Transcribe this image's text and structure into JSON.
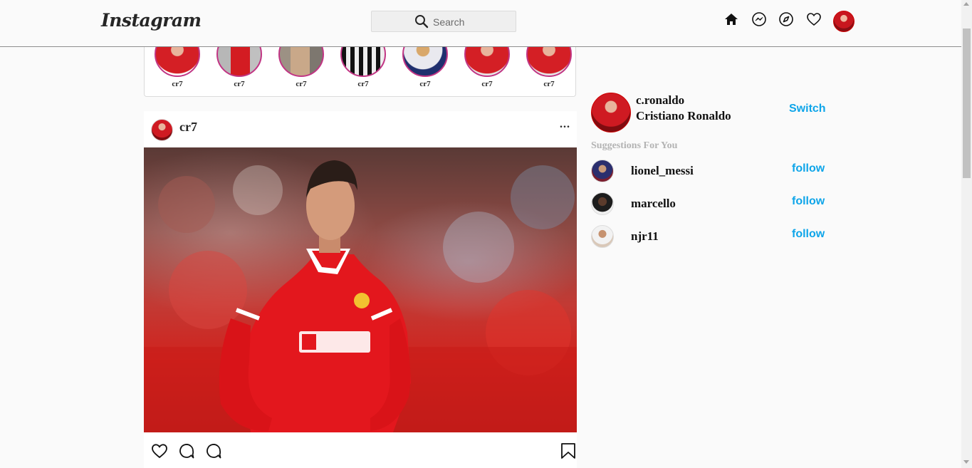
{
  "header": {
    "logo": "Instagram",
    "search_placeholder": "Search",
    "icons": [
      "home-icon",
      "messenger-icon",
      "explore-icon",
      "heart-icon",
      "profile-avatar"
    ]
  },
  "stories": [
    {
      "label": "cr7"
    },
    {
      "label": "cr7"
    },
    {
      "label": "cr7"
    },
    {
      "label": "cr7"
    },
    {
      "label": "cr7"
    },
    {
      "label": "cr7"
    },
    {
      "label": "cr7"
    }
  ],
  "post": {
    "username": "cr7",
    "more": "...",
    "image_description": "",
    "actions": [
      "heart-icon",
      "comment-icon",
      "comment-icon",
      "bookmark-icon"
    ]
  },
  "sidebar": {
    "username": "c.ronaldo",
    "fullname": "Cristiano Ronaldo",
    "switch_label": "Switch",
    "suggestions_title": "Suggestions For You",
    "suggestions": [
      {
        "name": "lionel_messi",
        "action": "follow"
      },
      {
        "name": "marcello",
        "action": "follow"
      },
      {
        "name": "njr11",
        "action": "follow"
      }
    ]
  },
  "colors": {
    "accent": "#0ea5e9",
    "story_ring": "#c13584",
    "background": "#fafafa"
  }
}
